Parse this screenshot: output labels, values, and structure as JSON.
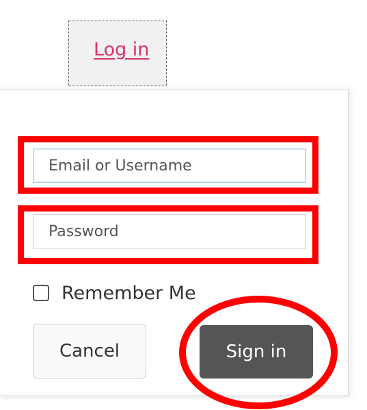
{
  "header": {
    "login_link": "Log in"
  },
  "login_form": {
    "email_placeholder": "Email or Username",
    "password_placeholder": "Password",
    "remember_me_label": "Remember Me",
    "remember_me_checked": false,
    "cancel_label": "Cancel",
    "signin_label": "Sign in"
  },
  "colors": {
    "link": "#d6336c",
    "signin_bg": "#555555",
    "annotation": "#ff0000"
  }
}
